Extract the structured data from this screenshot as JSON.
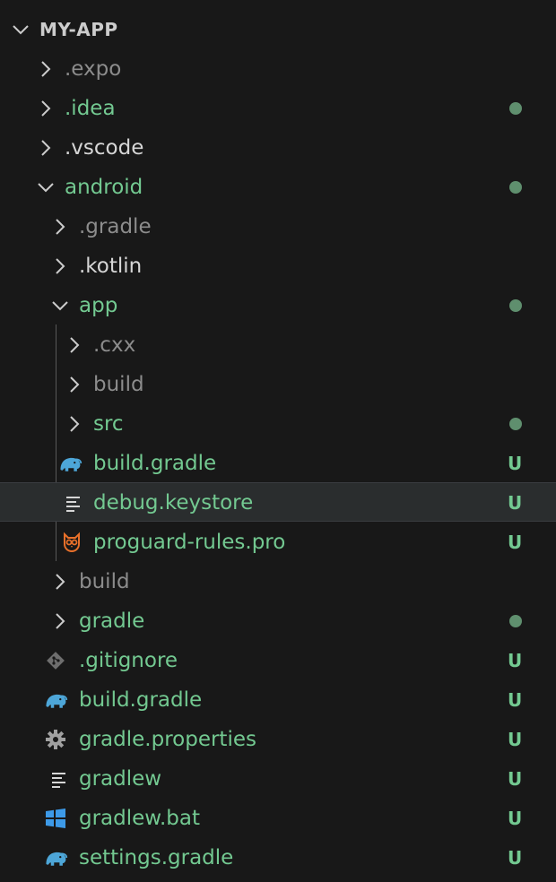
{
  "explorer": {
    "root_title": "MY-APP",
    "colors": {
      "untracked": "#73c991",
      "ignored": "#8c8c8c",
      "normal": "#d6d6d6",
      "selection": "#2a2d2e",
      "gradle_icon": "#4da6d8",
      "proguard_icon": "#e8702a",
      "windows_icon": "#3d9ae8"
    },
    "items": [
      {
        "label": ".expo",
        "status": ""
      },
      {
        "label": ".idea",
        "status": ""
      },
      {
        "label": ".vscode",
        "status": ""
      },
      {
        "label": "android",
        "status": ""
      },
      {
        "label": ".gradle",
        "status": ""
      },
      {
        "label": ".kotlin",
        "status": ""
      },
      {
        "label": "app",
        "status": ""
      },
      {
        "label": ".cxx",
        "status": ""
      },
      {
        "label": "build",
        "status": ""
      },
      {
        "label": "src",
        "status": ""
      },
      {
        "label": "build.gradle",
        "status": "U",
        "icon": "gradle-elephant-icon"
      },
      {
        "label": "debug.keystore",
        "status": "U",
        "icon": "text-file-icon"
      },
      {
        "label": "proguard-rules.pro",
        "status": "U",
        "icon": "proguard-owl-icon"
      },
      {
        "label": "build",
        "status": ""
      },
      {
        "label": "gradle",
        "status": ""
      },
      {
        "label": ".gitignore",
        "status": "U",
        "icon": "git-icon"
      },
      {
        "label": "build.gradle",
        "status": "U",
        "icon": "gradle-elephant-icon"
      },
      {
        "label": "gradle.properties",
        "status": "U",
        "icon": "gear-icon"
      },
      {
        "label": "gradlew",
        "status": "U",
        "icon": "text-file-icon"
      },
      {
        "label": "gradlew.bat",
        "status": "U",
        "icon": "windows-icon"
      },
      {
        "label": "settings.gradle",
        "status": "U",
        "icon": "gradle-elephant-icon"
      }
    ]
  }
}
